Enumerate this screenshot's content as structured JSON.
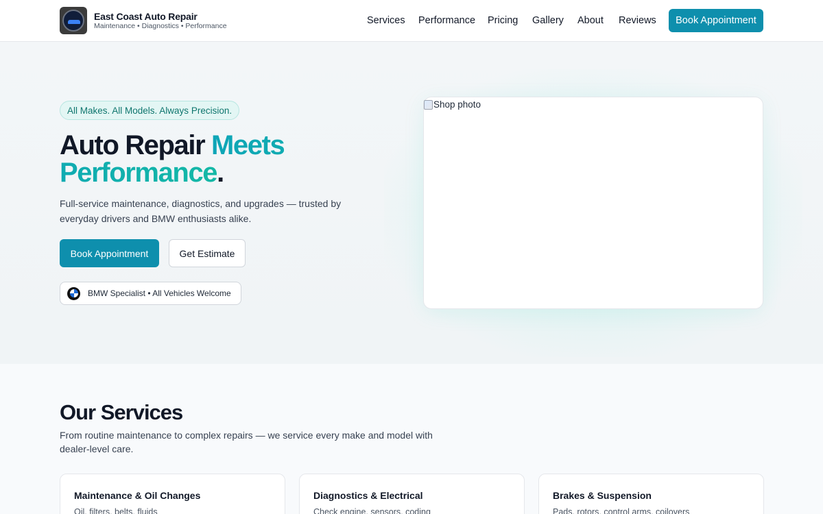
{
  "brand": {
    "name": "East Coast Auto Repair",
    "tagline": "Maintenance • Diagnostics • Performance"
  },
  "nav": {
    "items": [
      "Services",
      "Performance",
      "Pricing",
      "Gallery",
      "About",
      "Reviews"
    ],
    "cta": "Book Appointment"
  },
  "hero": {
    "pill": "All Makes. All Models. Always Precision.",
    "headline_plain": "Auto Repair ",
    "headline_accent": "Meets Performance",
    "headline_end": ".",
    "subtext": "Full-service maintenance, diagnostics, and upgrades — trusted by everyday drivers and BMW enthusiasts alike.",
    "primary_cta": "Book Appointment",
    "secondary_cta": "Get Estimate",
    "badge": "BMW Specialist • All Vehicles Welcome",
    "photo_alt": "Shop photo"
  },
  "services": {
    "title": "Our Services",
    "subtitle": "From routine maintenance to complex repairs — we service every make and model with dealer-level care.",
    "cards": [
      {
        "title": "Maintenance & Oil Changes",
        "desc": "Oil, filters, belts, fluids"
      },
      {
        "title": "Diagnostics & Electrical",
        "desc": "Check engine, sensors, coding"
      },
      {
        "title": "Brakes & Suspension",
        "desc": "Pads, rotors, control arms, coilovers"
      }
    ]
  },
  "colors": {
    "accent": "#0e8fad",
    "teal": "#14b8a6"
  }
}
